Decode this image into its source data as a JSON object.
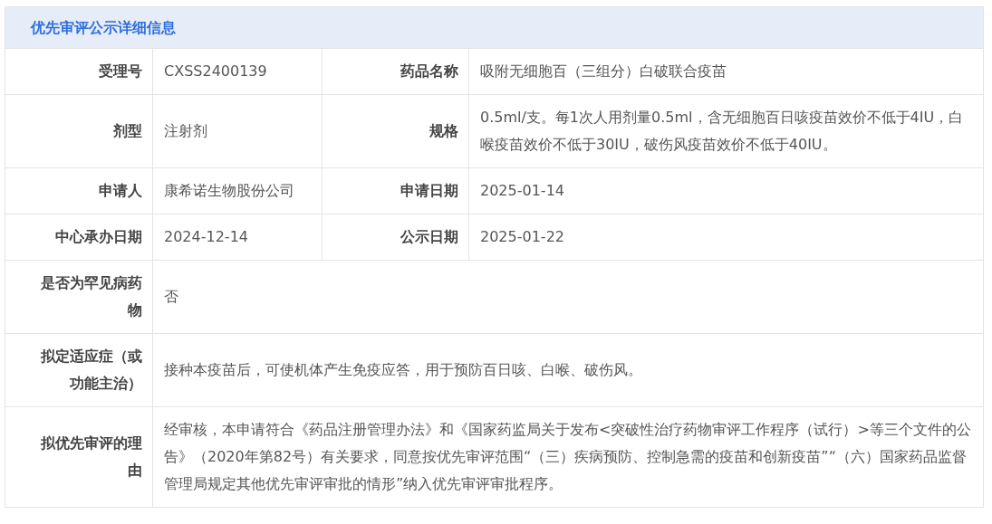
{
  "title": "优先审评公示详细信息",
  "rows": [
    {
      "cells": [
        {
          "label": "受理号",
          "value": "CXSS2400139"
        },
        {
          "label": "药品名称",
          "value": "吸附无细胞百（三组分）白破联合疫苗"
        }
      ]
    },
    {
      "cells": [
        {
          "label": "剂型",
          "value": "注射剂"
        },
        {
          "label": "规格",
          "value": "0.5ml/支。每1次人用剂量0.5ml，含无细胞百日咳疫苗效价不低于4IU，白喉疫苗效价不低于30IU，破伤风疫苗效价不低于40IU。"
        }
      ]
    },
    {
      "cells": [
        {
          "label": "申请人",
          "value": "康希诺生物股份公司"
        },
        {
          "label": "申请日期",
          "value": "2025-01-14"
        }
      ]
    },
    {
      "cells": [
        {
          "label": "中心承办日期",
          "value": "2024-12-14"
        },
        {
          "label": "公示日期",
          "value": "2025-01-22"
        }
      ]
    },
    {
      "cells": [
        {
          "label": "是否为罕见病药物",
          "value": "否"
        }
      ]
    },
    {
      "cells": [
        {
          "label": "拟定适应症（或功能主治）",
          "value": "接种本疫苗后，可使机体产生免疫应答，用于预防百日咳、白喉、破伤风。"
        }
      ]
    },
    {
      "cells": [
        {
          "label": "拟优先审评的理由",
          "value": "经审核，本申请符合《药品注册管理办法》和《国家药监局关于发布<突破性治疗药物审评工作程序（试行）>等三个文件的公告》（2020年第82号）有关要求，同意按优先审评范围“（三）疾病预防、控制急需的疫苗和创新疫苗”“（六）国家药品监督管理局规定其他优先审评审批的情形”纳入优先审评审批程序。"
        }
      ]
    }
  ]
}
